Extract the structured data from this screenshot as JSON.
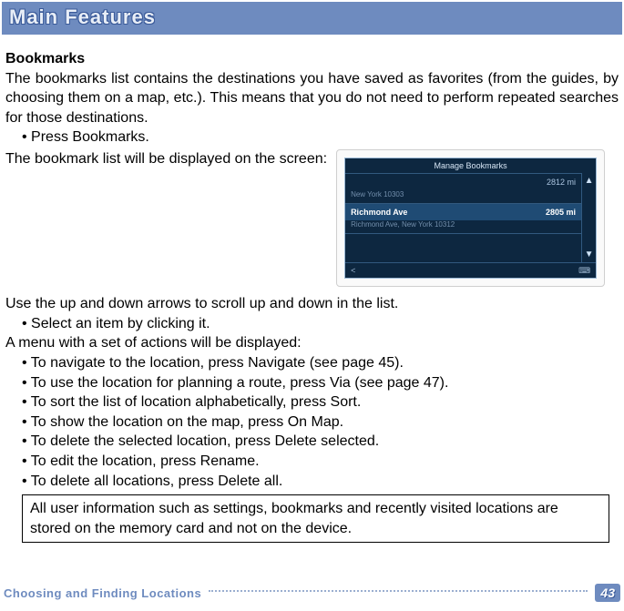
{
  "header": {
    "title": "Main Features"
  },
  "section": {
    "name": "Bookmarks"
  },
  "p": {
    "intro": "The bookmarks list contains the destinations you have saved as favorites (from the guides, by choosing them on a map, etc.). This means that you do not need to perform repeated searches for those destinations.",
    "press_bookmarks": "• Press Bookmarks.",
    "displayed": "The bookmark list will be displayed on the screen:",
    "use_arrows": "Use the up and down arrows to scroll up and down in the list.",
    "select_item": "• Select an item by clicking it.",
    "menu_displayed": "A menu with a set of actions will be displayed:",
    "b1": "• To navigate to the location, press Navigate (see page 45).",
    "b2": "• To use the location for planning a route, press Via (see page 47).",
    "b3": "• To sort the list of location alphabetically, press Sort.",
    "b4": "• To show the location on the map, press On Map.",
    "b5": "• To delete the selected location, press Delete selected.",
    "b6": "• To edit the location, press Rename.",
    "b7": "• To delete all locations, press Delete all."
  },
  "note": "All user information such as settings, bookmarks and recently visited locations are stored on the memory card and not on the device.",
  "bm_screen": {
    "title": "Manage Bookmarks",
    "rows": [
      {
        "name": "",
        "sub": "New York 10303",
        "dist": "2812 mi"
      },
      {
        "name": "Richmond Ave",
        "sub": "Richmond Ave, New York 10312",
        "dist": "2805 mi"
      }
    ]
  },
  "footer": {
    "section": "Choosing and Finding Locations",
    "page": "43"
  }
}
